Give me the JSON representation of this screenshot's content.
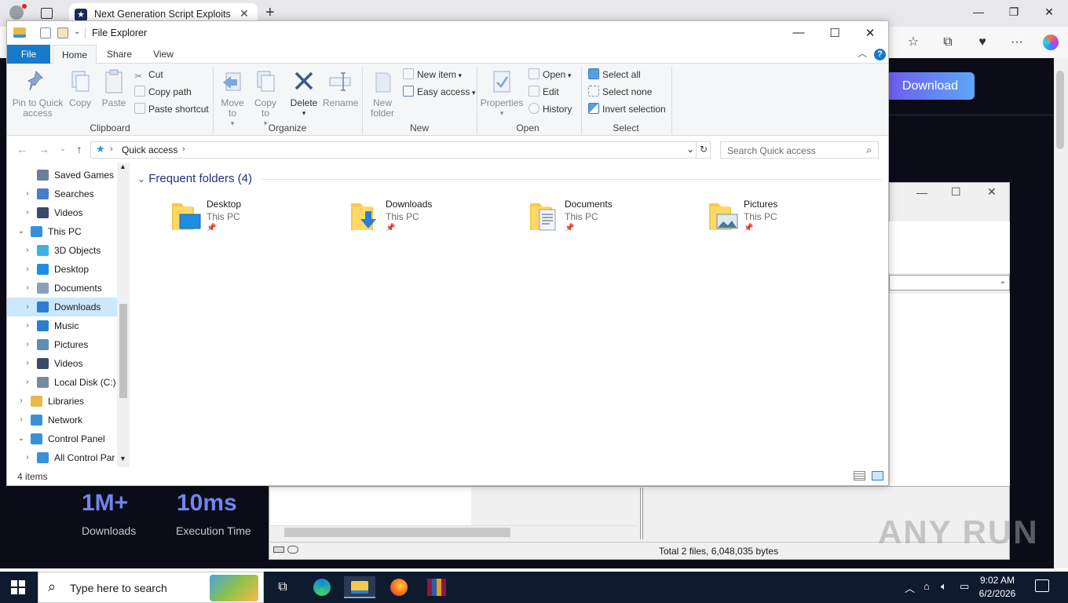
{
  "browser": {
    "tab_title": "Next Generation Script Exploits",
    "tab_close": "✕",
    "new_tab": "+",
    "win_min": "—",
    "win_restore": "❐",
    "win_close": "✕",
    "toolbar_icons": [
      "favorites-icon",
      "collections-icon",
      "extensions-icon",
      "more-icon",
      "copilot-icon"
    ]
  },
  "web": {
    "download_label": "Download",
    "stats": [
      {
        "value": "1M+",
        "label": "Downloads"
      },
      {
        "value": "10ms",
        "label": "Execution Time"
      }
    ]
  },
  "archive_window": {
    "status_text": "Total 2 files, 6,048,035 bytes"
  },
  "explorer": {
    "title": "File Explorer",
    "win_min": "—",
    "win_max": "☐",
    "win_close": "✕",
    "ribbon_tabs": {
      "file": "File",
      "home": "Home",
      "share": "Share",
      "view": "View"
    },
    "help": "?",
    "clipboard": {
      "label": "Clipboard",
      "pin": "Pin to Quick access",
      "copy": "Copy",
      "paste": "Paste",
      "cut": "Cut",
      "copy_path": "Copy path",
      "paste_shortcut": "Paste shortcut"
    },
    "organize": {
      "label": "Organize",
      "move_to": "Move to",
      "copy_to": "Copy to",
      "delete": "Delete",
      "rename": "Rename"
    },
    "new": {
      "label": "New",
      "new_folder": "New folder",
      "new_item": "New item",
      "easy_access": "Easy access"
    },
    "open": {
      "label": "Open",
      "properties": "Properties",
      "open": "Open",
      "edit": "Edit",
      "history": "History"
    },
    "select": {
      "label": "Select",
      "select_all": "Select all",
      "select_none": "Select none",
      "invert": "Invert selection"
    },
    "address": {
      "location": "Quick access",
      "search_placeholder": "Search Quick access"
    },
    "nav": [
      {
        "label": "Saved Games",
        "indent": 2,
        "chev": "",
        "icon": "saved-games-icon",
        "color": "#6b7f9a"
      },
      {
        "label": "Searches",
        "indent": 2,
        "chev": "›",
        "icon": "search-icon",
        "color": "#4a7cc7"
      },
      {
        "label": "Videos",
        "indent": 2,
        "chev": "›",
        "icon": "videos-icon",
        "color": "#3b4a66"
      },
      {
        "label": "This PC",
        "indent": 1,
        "chev": "⌄",
        "icon": "computer-icon",
        "color": "#3a8fd8"
      },
      {
        "label": "3D Objects",
        "indent": 2,
        "chev": "›",
        "icon": "3d-objects-icon",
        "color": "#39b3e6"
      },
      {
        "label": "Desktop",
        "indent": 2,
        "chev": "›",
        "icon": "desktop-icon",
        "color": "#1e8fe0"
      },
      {
        "label": "Documents",
        "indent": 2,
        "chev": "›",
        "icon": "documents-icon",
        "color": "#8aa0b8"
      },
      {
        "label": "Downloads",
        "indent": 2,
        "chev": "›",
        "icon": "downloads-icon",
        "color": "#2a7fd4"
      },
      {
        "label": "Music",
        "indent": 2,
        "chev": "›",
        "icon": "music-icon",
        "color": "#2a7fd4"
      },
      {
        "label": "Pictures",
        "indent": 2,
        "chev": "›",
        "icon": "pictures-icon",
        "color": "#5c8fb5"
      },
      {
        "label": "Videos",
        "indent": 2,
        "chev": "›",
        "icon": "videos-icon",
        "color": "#3b4a66"
      },
      {
        "label": "Local Disk (C:)",
        "indent": 2,
        "chev": "›",
        "icon": "drive-icon",
        "color": "#7a8a9a"
      },
      {
        "label": "Libraries",
        "indent": 1,
        "chev": "›",
        "icon": "libraries-icon",
        "color": "#e8b84a"
      },
      {
        "label": "Network",
        "indent": 1,
        "chev": "›",
        "icon": "network-icon",
        "color": "#3a8fd8"
      },
      {
        "label": "Control Panel",
        "indent": 1,
        "chev": "⌄",
        "icon": "control-panel-icon",
        "color": "#3a8fd8"
      },
      {
        "label": "All Control Par",
        "indent": 2,
        "chev": "›",
        "icon": "control-panel-icon",
        "color": "#3a8fd8"
      }
    ],
    "frequent_header": "Frequent folders (4)",
    "folders": [
      {
        "name": "Desktop",
        "location": "This PC",
        "overlay": "desktop"
      },
      {
        "name": "Downloads",
        "location": "This PC",
        "overlay": "downloads"
      },
      {
        "name": "Documents",
        "location": "This PC",
        "overlay": "documents"
      },
      {
        "name": "Pictures",
        "location": "This PC",
        "overlay": "pictures"
      }
    ],
    "status": "4 items"
  },
  "taskbar": {
    "search_text": "Type here to search",
    "time": "9:02 AM",
    "date": "6/2/2026"
  },
  "watermark": "ANY RUN"
}
